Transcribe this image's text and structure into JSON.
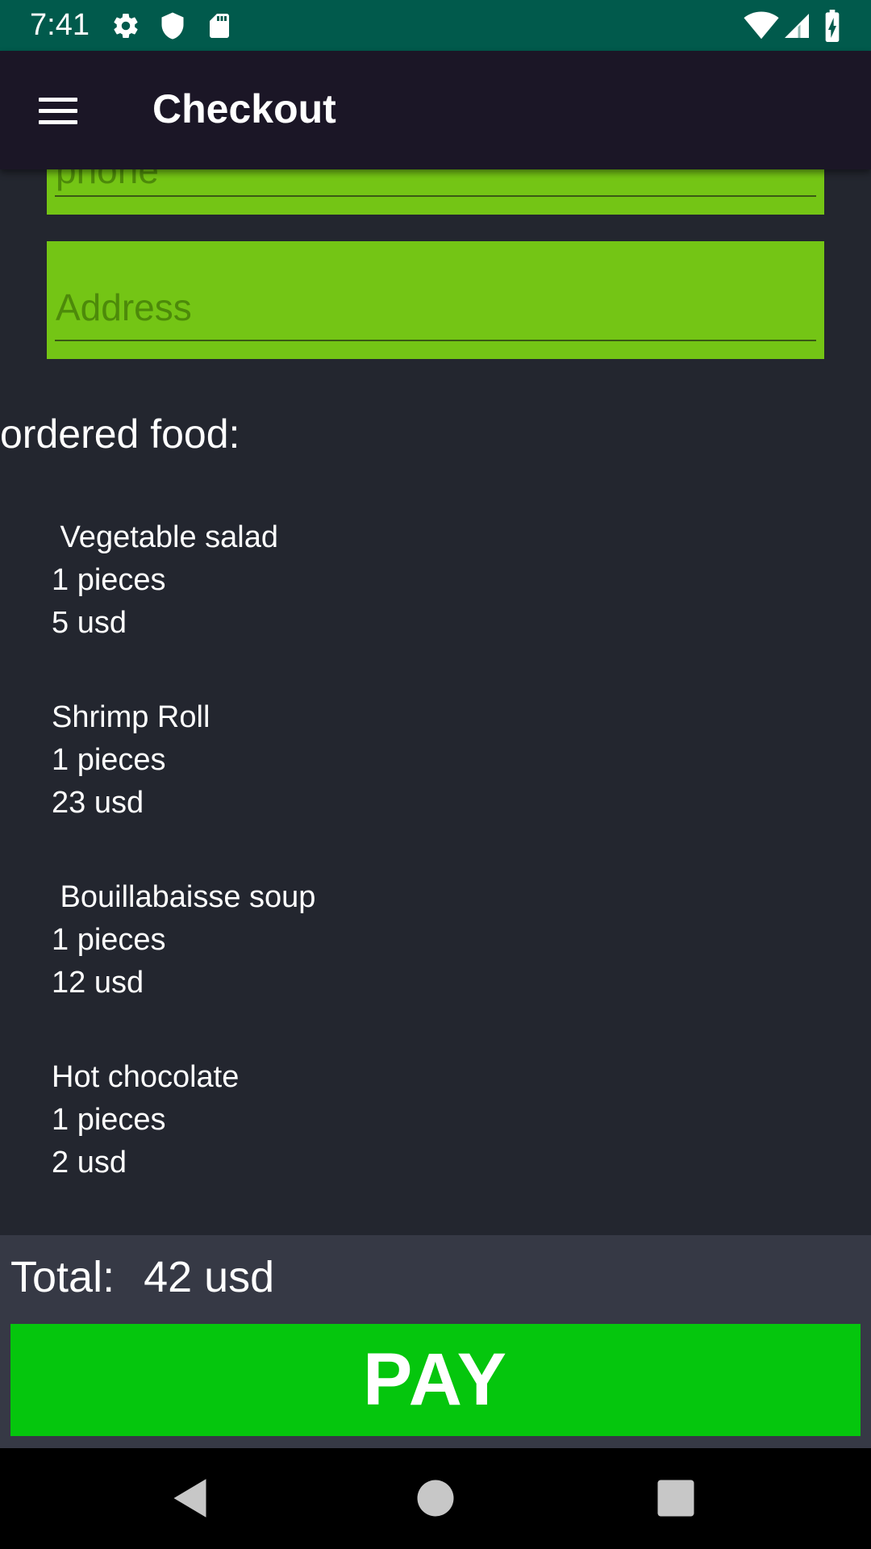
{
  "status_bar": {
    "time": "7:41",
    "left_icons": [
      "gear-icon",
      "shield-icon",
      "sd-card-icon"
    ],
    "right_icons": [
      "wifi-icon",
      "cell-signal-icon",
      "battery-charging-icon"
    ],
    "background": "#015a4c"
  },
  "toolbar": {
    "title": "Checkout",
    "menu_icon": "hamburger-menu-icon",
    "background": "#1b1626"
  },
  "form": {
    "phone": {
      "placeholder": "phone",
      "value": ""
    },
    "address": {
      "placeholder": "Address",
      "value": ""
    },
    "field_color": "#74c515"
  },
  "order": {
    "title": "ordered food:",
    "items": [
      {
        "name": " Vegetable salad",
        "quantity": "1 pieces",
        "price": "5 usd"
      },
      {
        "name": "Shrimp Roll",
        "quantity": "1 pieces",
        "price": "23 usd"
      },
      {
        "name": " Bouillabaisse soup",
        "quantity": "1 pieces",
        "price": "12 usd"
      },
      {
        "name": "Hot chocolate",
        "quantity": "1 pieces",
        "price": "2 usd"
      }
    ]
  },
  "summary": {
    "total_label": "Total:",
    "total_value": "42 usd"
  },
  "actions": {
    "pay_label": "PAY",
    "pay_color": "#05c60d"
  },
  "nav_bar": {
    "buttons": [
      "back-icon",
      "home-icon",
      "recents-icon"
    ]
  }
}
